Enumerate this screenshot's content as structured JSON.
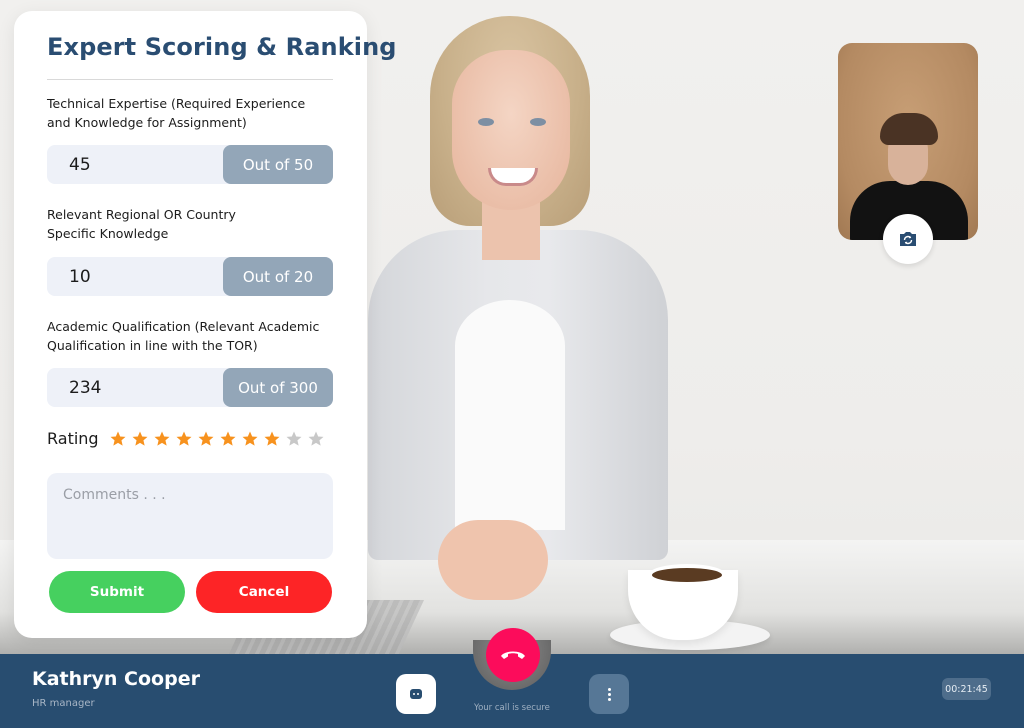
{
  "scoring_card": {
    "title": "Expert Scoring & Ranking",
    "criteria": [
      {
        "label_line1": "Technical Expertise (Required Experience",
        "label_line2": "and Knowledge for Assignment)",
        "value": "45",
        "max_label": "Out of 50"
      },
      {
        "label_line1": "Relevant Regional OR Country",
        "label_line2": "Specific Knowledge",
        "value": "10",
        "max_label": "Out of 20"
      },
      {
        "label_line1": "Academic Qualification (Relevant Academic",
        "label_line2": "Qualification in line with the TOR)",
        "value": "234",
        "max_label": "Out of 300"
      }
    ],
    "rating": {
      "label": "Rating",
      "value": 8,
      "max": 10
    },
    "comments": {
      "value": "",
      "placeholder": "Comments . . ."
    },
    "submit_label": "Submit",
    "cancel_label": "Cancel"
  },
  "colors": {
    "title": "#2a4d72",
    "star_filled": "#f7921e",
    "star_empty": "#c8c8c8",
    "submit": "#46d05f",
    "cancel": "#fd2426",
    "hangup": "#fc0c5b",
    "callbar": "#284d70"
  },
  "call": {
    "caller_name": "Kathryn Cooper",
    "caller_role": "HR manager",
    "secure_text": "Your call is secure",
    "timer": "00:21:45",
    "icons": {
      "chat": "chat-bubble-icon",
      "hangup": "phone-hangup-icon",
      "more": "more-vertical-icon",
      "switch_camera": "camera-switch-icon"
    }
  }
}
